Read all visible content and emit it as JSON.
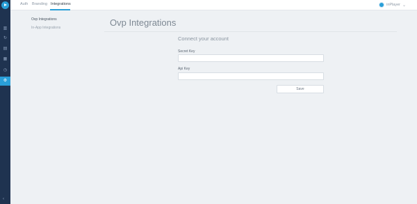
{
  "sidebar": {
    "items": [
      {
        "icon": "bar-chart-icon"
      },
      {
        "icon": "refresh-icon"
      },
      {
        "icon": "analytics-icon"
      },
      {
        "icon": "calendar-icon"
      },
      {
        "icon": "clock-icon"
      },
      {
        "icon": "gear-icon",
        "active": true
      }
    ],
    "collapse_icon": "chevron-left-icon"
  },
  "header": {
    "tabs": [
      {
        "label": "Auth"
      },
      {
        "label": "Branding"
      },
      {
        "label": "Integrations",
        "active": true
      }
    ],
    "user_name": "inPlayer"
  },
  "subnav": {
    "items": [
      {
        "label": "Ovp Integrations",
        "active": true
      },
      {
        "label": "In-App Integrations"
      }
    ]
  },
  "main": {
    "title": "Ovp Integrations",
    "section_title": "Connect your account",
    "secret_key_label": "Secret Key",
    "secret_key_value": "",
    "api_key_label": "Api Key",
    "api_key_value": "",
    "save_label": "Save"
  },
  "colors": {
    "accent": "#2a9fd8",
    "sidebar_bg": "#1f3350",
    "page_bg": "#eef1f4"
  }
}
